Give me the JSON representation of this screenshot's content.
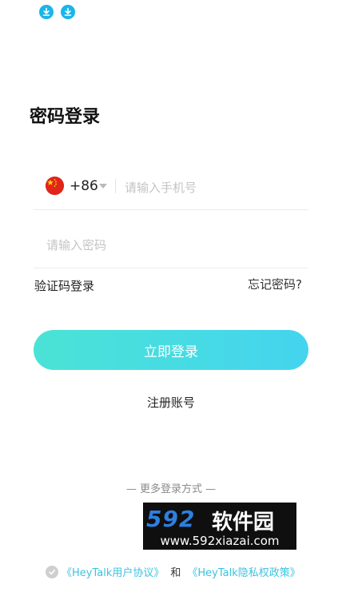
{
  "page": {
    "title": "密码登录"
  },
  "status_bar": {
    "icons": [
      "download-icon",
      "download-icon"
    ],
    "icon_color": "#19b5ea"
  },
  "phone_field": {
    "country_flag": "china-flag-icon",
    "country_code": "+86",
    "placeholder": "请输入手机号",
    "value": ""
  },
  "password_field": {
    "placeholder": "请输入密码",
    "value": ""
  },
  "links": {
    "code_login": "验证码登录",
    "forgot_password": "忘记密码?"
  },
  "login_button": {
    "label": "立即登录",
    "gradient_start": "#4ae3d5",
    "gradient_end": "#44d4ef"
  },
  "register": {
    "label": "注册账号"
  },
  "more_login": {
    "label": "— 更多登录方式 —"
  },
  "watermark": {
    "brand_number": "592",
    "brand_text": "软件园",
    "url": "www.592xiazai.com"
  },
  "agreement": {
    "check_icon": "check-circle-icon",
    "user_agreement": "《HeyTalk用户协议》",
    "and": "和",
    "privacy_policy": "《HeyTalk隐私权政策》",
    "link_color": "#3cc3df"
  }
}
